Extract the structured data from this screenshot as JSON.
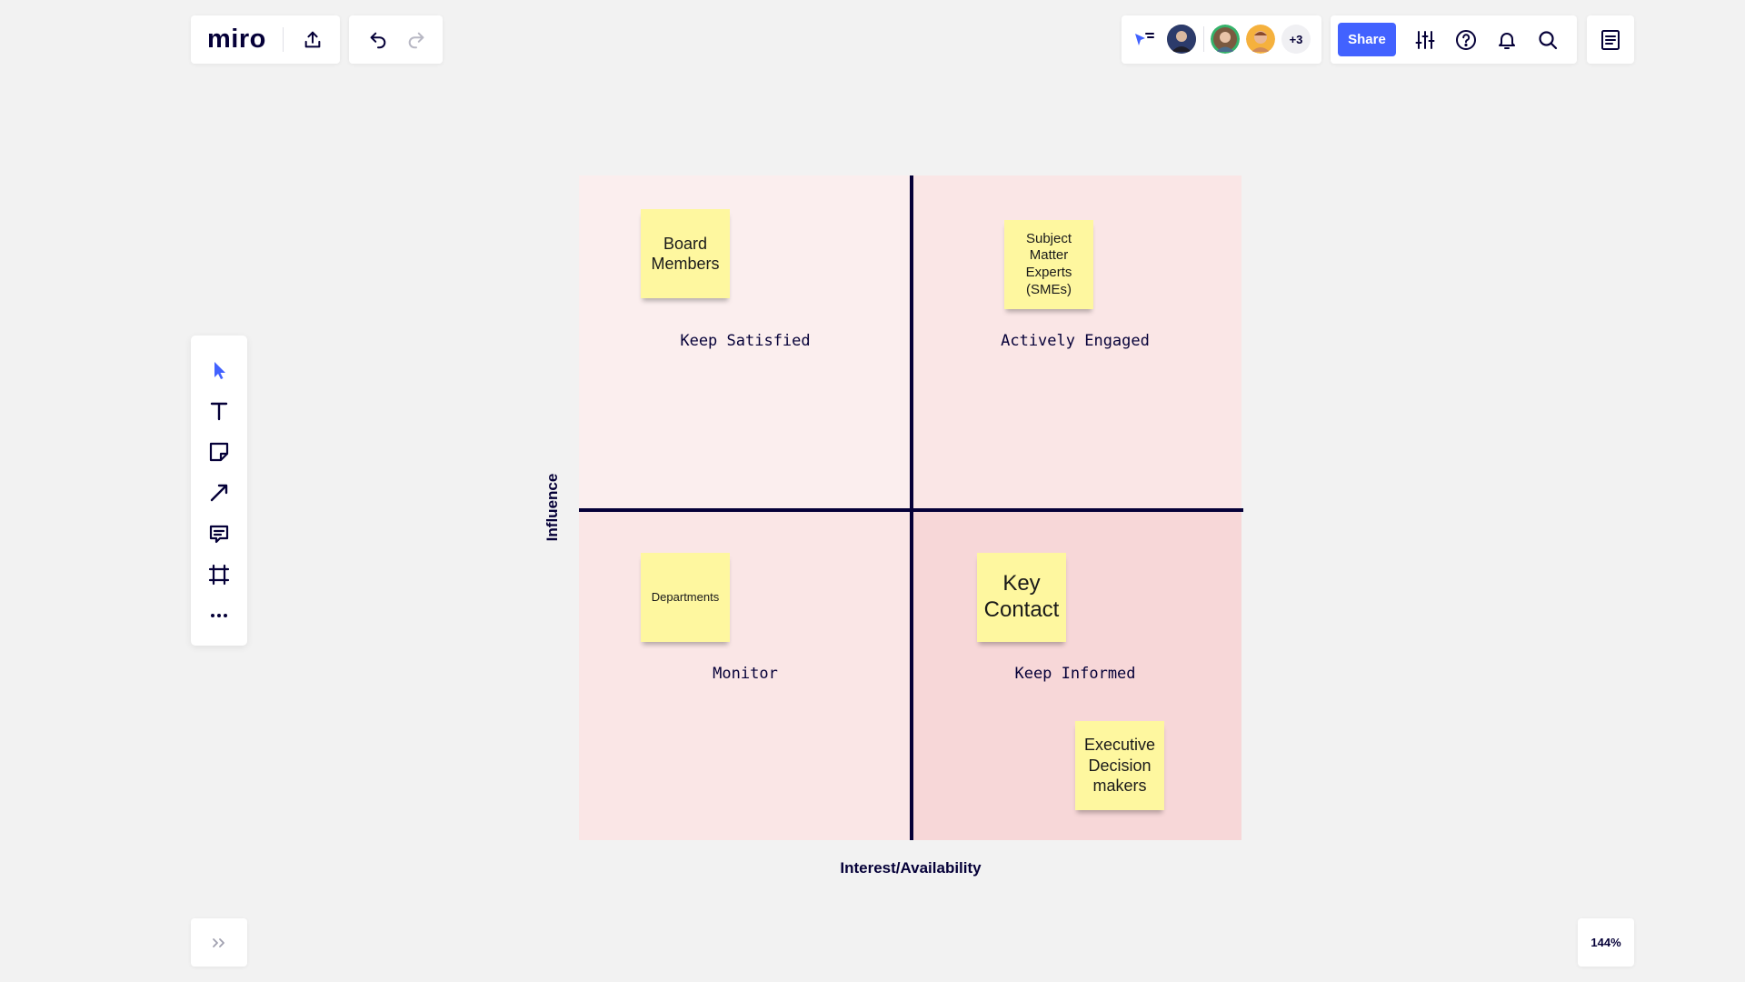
{
  "app": {
    "logo": "miro"
  },
  "header": {
    "extra_users_count": "+3",
    "share_label": "Share"
  },
  "board": {
    "y_axis_label": "Influence",
    "x_axis_label": "Interest/Availability",
    "quadrants": {
      "top_left": "Keep Satisfied",
      "top_right": "Actively Engaged",
      "bottom_left": "Monitor",
      "bottom_right": "Keep Informed"
    },
    "stickies": {
      "board_members": "Board Members",
      "smes": "Subject Matter Experts (SMEs)",
      "departments": "Departments",
      "key_contact": "Key Contact",
      "executive": "Executive Decision makers"
    },
    "colors": {
      "accent": "#4262ff",
      "ink": "#050038",
      "sticky": "#fef79f",
      "quad_top_left": "#fbeeee",
      "quad_top_right": "#fae6e6",
      "quad_bottom_left": "#fae6e6",
      "quad_bottom_right": "#f7d7d8"
    }
  },
  "footer": {
    "zoom": "144%"
  },
  "icons": {
    "top_left": [
      "export-icon"
    ],
    "history": [
      "undo-icon",
      "redo-icon"
    ],
    "collab": [
      "cursor-follow-icon"
    ],
    "toolbar_right": [
      "settings-sliders-icon",
      "help-icon",
      "bell-icon",
      "search-icon"
    ],
    "notes": "notes-icon",
    "left_toolbar": [
      "select-cursor-icon",
      "text-icon",
      "sticky-note-icon",
      "line-arrow-icon",
      "comment-icon",
      "frame-icon",
      "more-icon"
    ],
    "bottom": "expand-icon"
  }
}
